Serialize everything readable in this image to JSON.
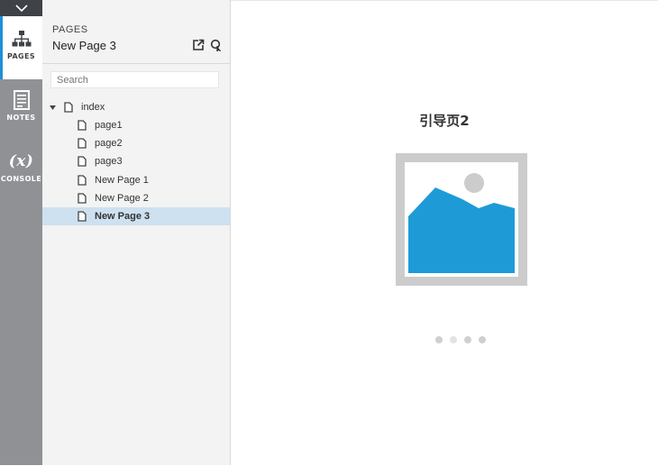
{
  "rail": {
    "items": [
      {
        "label": "PAGES",
        "icon": "sitemap-icon",
        "active": true
      },
      {
        "label": "NOTES",
        "icon": "notes-icon",
        "active": false
      },
      {
        "label": "CONSOLE",
        "icon": "variable-icon",
        "glyph": "(x)",
        "active": false
      }
    ]
  },
  "panel": {
    "section": "PAGES",
    "title": "New Page 3",
    "search_placeholder": "Search",
    "tree": [
      {
        "label": "index",
        "level": 0,
        "expanded": true
      },
      {
        "label": "page1",
        "level": 1
      },
      {
        "label": "page2",
        "level": 1
      },
      {
        "label": "page3",
        "level": 1
      },
      {
        "label": "New Page 1",
        "level": 1
      },
      {
        "label": "New Page 2",
        "level": 1
      },
      {
        "label": "New Page 3",
        "level": 1,
        "selected": true
      }
    ]
  },
  "main": {
    "heading": "引导页2",
    "carousel": {
      "count": 4,
      "active_index": 1
    }
  },
  "colors": {
    "accent": "#1e90d6",
    "image_blue": "#1e9bd7",
    "selected_row": "#cde1f1",
    "rail": "#8f9195"
  }
}
